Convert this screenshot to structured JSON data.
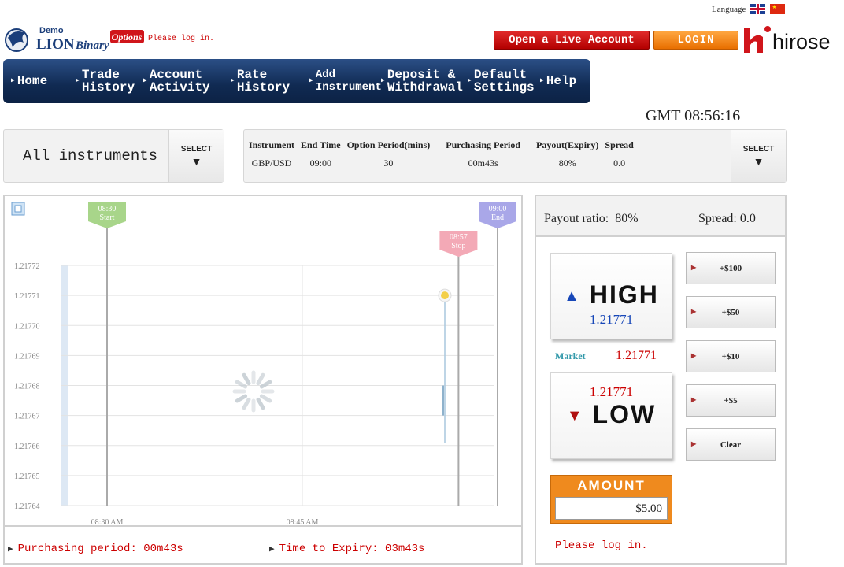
{
  "header": {
    "language_label": "Language",
    "logo": {
      "top": "Demo",
      "brand": "LION",
      "binary": "Binary",
      "options": "Options"
    },
    "login_message": "Please log in.",
    "open_live_label": "Open a Live Account",
    "login_label": "LOGIN",
    "hirose_label": "hirose"
  },
  "nav": {
    "items": [
      {
        "label": "Home"
      },
      {
        "label": "Trade\nHistory"
      },
      {
        "label": "Account\nActivity"
      },
      {
        "label": "Rate\nHistory"
      },
      {
        "label": "Add\nInstrument"
      },
      {
        "label": "Deposit &\nWithdrawal"
      },
      {
        "label": "Default\nSettings"
      },
      {
        "label": "Help"
      }
    ]
  },
  "clock": "GMT 08:56:16",
  "instrument_selector": {
    "label": "All instruments",
    "select_label": "SELECT"
  },
  "info_table": {
    "headers": [
      "Instrument",
      "End Time",
      "Option Period(mins)",
      "Purchasing Period",
      "Payout(Expiry)",
      "Spread"
    ],
    "values": [
      "GBP/USD",
      "09:00",
      "30",
      "00m43s",
      "80%",
      "0.0"
    ],
    "select_label": "SELECT"
  },
  "chart_data": {
    "type": "line",
    "ylim": [
      1.21764,
      1.21772
    ],
    "y_ticks": [
      "1.21772",
      "1.21771",
      "1.21770",
      "1.21769",
      "1.21768",
      "1.21767",
      "1.21766",
      "1.21765",
      "1.21764"
    ],
    "x_ticks": [
      "08:30 AM",
      "08:45 AM"
    ],
    "markers": [
      {
        "time": "08:30",
        "label": "Start",
        "color": "#a8d58a"
      },
      {
        "time": "08:57",
        "label": "Stop",
        "color": "#f3a9b6"
      },
      {
        "time": "09:00",
        "label": "End",
        "color": "#a9a7e8"
      }
    ],
    "current_rate": 1.21771
  },
  "footer": {
    "purchasing_period": "Purchasing period: 00m43s",
    "time_to_expiry": "Time to Expiry: 03m43s"
  },
  "trade": {
    "payout_ratio": "Payout ratio:  80%",
    "spread": "Spread: 0.0",
    "high_label": "HIGH",
    "high_price": "1.21771",
    "market_label": "Market",
    "market_price": "1.21771",
    "low_price": "1.21771",
    "low_label": "LOW",
    "amount_buttons": [
      "+$100",
      "+$50",
      "+$10",
      "+$5",
      "Clear"
    ],
    "amount_label": "AMOUNT",
    "amount_value": "$5.00",
    "message": "Please log in."
  }
}
